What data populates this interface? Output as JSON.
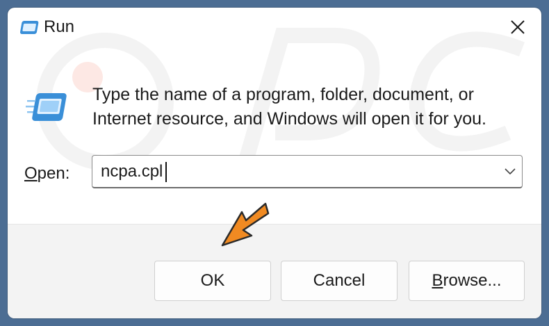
{
  "window": {
    "title": "Run"
  },
  "icons": {
    "app": "run-icon",
    "close": "close-icon",
    "program": "run-icon",
    "dropdown": "chevron-down-icon",
    "annotation": "orange-arrow-icon"
  },
  "description": {
    "line1": "Type the name of a program, folder, document, or",
    "line2": "Internet resource, and Windows will open it for you."
  },
  "open_field": {
    "label_mnemonic": "O",
    "label_rest": "pen:",
    "value": "ncpa.cpl"
  },
  "buttons": {
    "ok": "OK",
    "cancel": "Cancel",
    "browse_mnemonic": "B",
    "browse_rest": "rowse..."
  },
  "colors": {
    "background": "#4c6d93",
    "arrow": "#f08a22",
    "icon_blue": "#3a8fd8"
  }
}
